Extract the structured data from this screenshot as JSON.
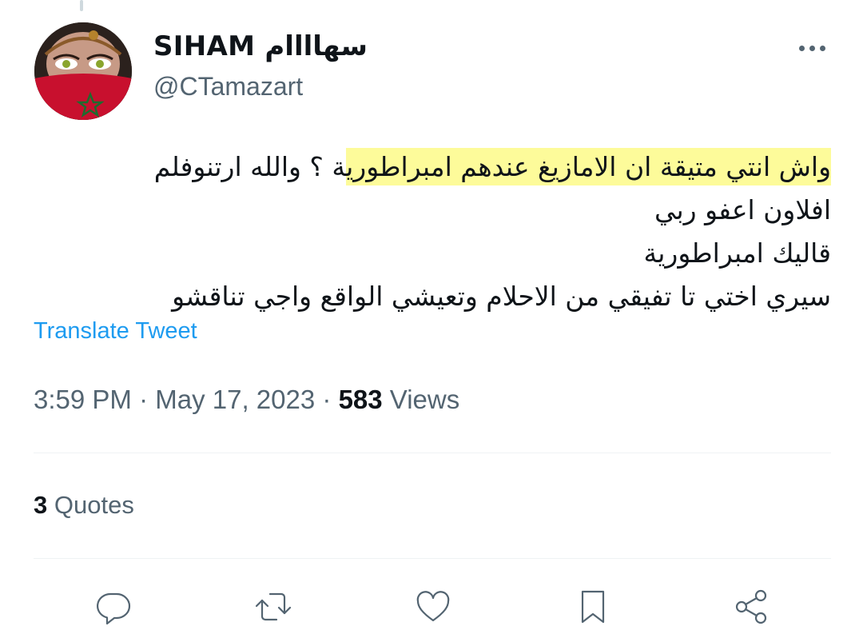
{
  "author": {
    "display_name": "SIHAM سهاااام",
    "handle": "@CTamazart"
  },
  "tweet": {
    "lines": [
      {
        "highlighted": "واش انتي متيقة ان الامازيغ عندهم امبراطوري",
        "rest": "ة ؟ والله ارتنوفلم"
      },
      {
        "text": "افلاون اعفو ربي"
      },
      {
        "text": "قاليك امبراطورية"
      },
      {
        "text": "سيري اختي تا تفيقي من الاحلام وتعيشي الواقع واجي تناقشو"
      }
    ],
    "translate_label": "Translate Tweet"
  },
  "meta": {
    "time": "3:59 PM",
    "date": "May 17, 2023",
    "views_count": "583",
    "views_label": "Views",
    "separator": "·"
  },
  "stats": {
    "quotes_count": "3",
    "quotes_label": "Quotes"
  },
  "actions": {
    "icons": [
      "reply-icon",
      "retweet-icon",
      "like-icon",
      "bookmark-icon",
      "share-icon"
    ]
  },
  "colors": {
    "link": "#1d9bf0",
    "muted": "#536471",
    "text": "#0f1419",
    "highlight": "#fdfb9a",
    "divider": "#eff3f4"
  }
}
